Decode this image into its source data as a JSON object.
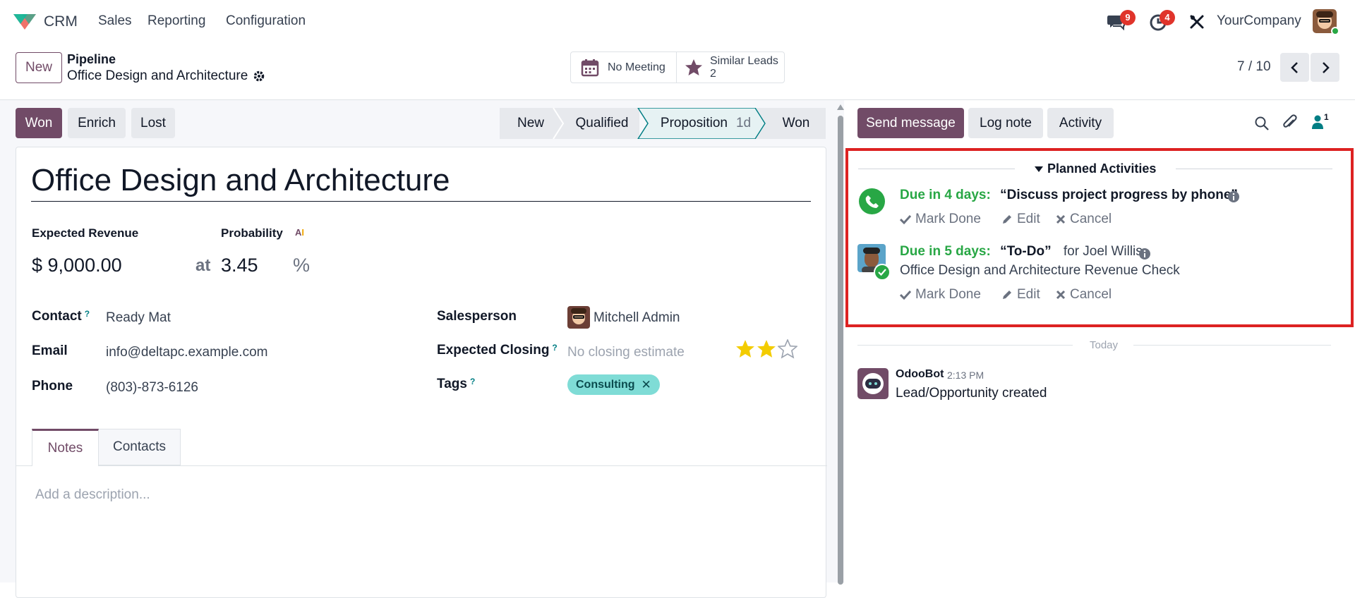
{
  "navbar": {
    "app_name": "CRM",
    "menus": [
      "Sales",
      "Reporting",
      "Configuration"
    ],
    "messages_count": "9",
    "activities_count": "4",
    "company": "YourCompany"
  },
  "control": {
    "new_label": "New",
    "breadcrumb_parent": "Pipeline",
    "breadcrumb_current": "Office Design and Architecture",
    "meeting_label": "No Meeting",
    "similar_label": "Similar Leads",
    "similar_count": "2",
    "pager": "7 / 10"
  },
  "actions": {
    "won": "Won",
    "enrich": "Enrich",
    "lost": "Lost"
  },
  "stages": [
    {
      "label": "New"
    },
    {
      "label": "Qualified"
    },
    {
      "label": "Proposition",
      "duration": "1d"
    },
    {
      "label": "Won"
    }
  ],
  "form": {
    "title": "Office Design and Architecture",
    "expected_revenue_label": "Expected Revenue",
    "probability_label": "Probability",
    "revenue": "$ 9,000.00",
    "at": "at",
    "probability": "3.45",
    "percent": "%",
    "contact_label": "Contact",
    "contact": "Ready Mat",
    "email_label": "Email",
    "email": "info@deltapc.example.com",
    "phone_label": "Phone",
    "phone": "(803)-873-6126",
    "salesperson_label": "Salesperson",
    "salesperson": "Mitchell Admin",
    "closing_label": "Expected Closing",
    "closing_placeholder": "No closing estimate",
    "priority_stars": 2,
    "priority_max": 3,
    "tags_label": "Tags",
    "tag": "Consulting",
    "q_mark": "?",
    "tabs": [
      "Notes",
      "Contacts"
    ],
    "description_placeholder": "Add a description..."
  },
  "chatter": {
    "send_message": "Send message",
    "log_note": "Log note",
    "activity": "Activity",
    "followers_count": "1",
    "planned_title": "Planned Activities",
    "activities": [
      {
        "due": "Due in 4 days:",
        "summary": "“Discuss project progress by phone”",
        "for_text": ""
      },
      {
        "due": "Due in 5 days:",
        "summary": "“To-Do”",
        "for_text": "for Joel Willis",
        "note": "Office Design and Architecture Revenue Check"
      }
    ],
    "mark_done": "Mark Done",
    "edit": "Edit",
    "cancel": "Cancel",
    "today": "Today",
    "message_author": "OdooBot",
    "message_time": "2:13 PM",
    "message_body": "Lead/Opportunity created"
  },
  "colors": {
    "primary": "#714b67",
    "stage_active_bg": "#e6f2f3",
    "stage_active_border": "#017e84",
    "highlight_border": "#dd2222",
    "tag_bg": "#7fdcd6",
    "star": "#f3cc00"
  }
}
